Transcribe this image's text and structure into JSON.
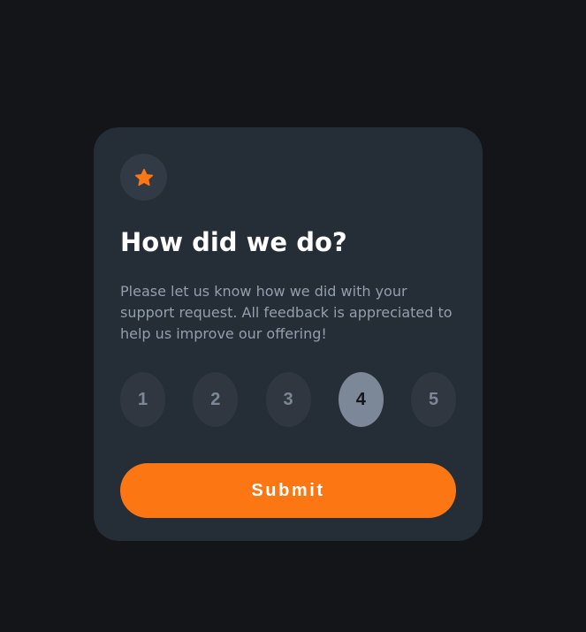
{
  "card": {
    "icon": "star-icon",
    "title": "How did we do?",
    "description": "Please let us know how we did with your support request. All feedback is appreciated to help us improve our offering!",
    "ratings": [
      "1",
      "2",
      "3",
      "4",
      "5"
    ],
    "selected_rating": "4",
    "submit_label": "Submit"
  },
  "colors": {
    "page_background": "#131518",
    "card_background": "#252d37",
    "accent": "#fc7614",
    "muted_text": "#959eac",
    "rating_background": "#303740",
    "rating_selected_background": "#7c8798"
  }
}
